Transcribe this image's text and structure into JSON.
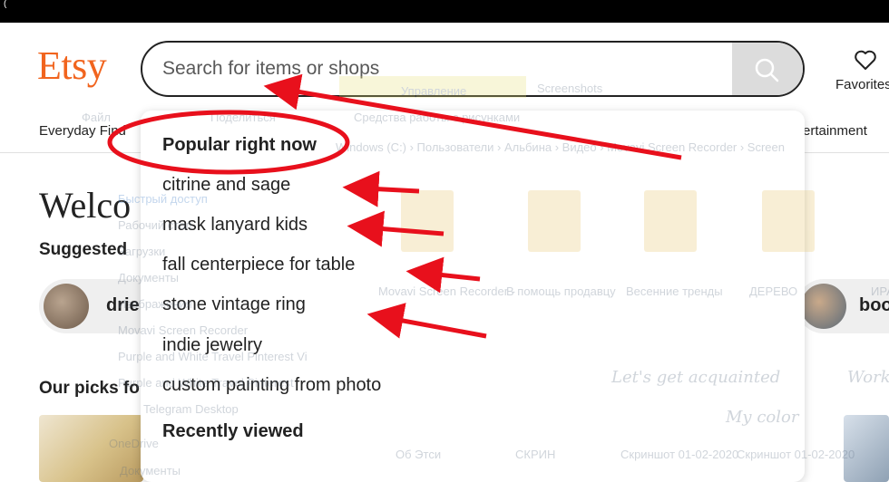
{
  "site": {
    "logo": "Etsy"
  },
  "search": {
    "placeholder": "Search for items or shops"
  },
  "header": {
    "favorites_label": "Favorites",
    "nav_left": "Everyday Find",
    "nav_right": "ertainment"
  },
  "main": {
    "welcome": "Welco",
    "suggested_heading": "Suggested",
    "suggested_left": "drie",
    "suggested_right": "boo",
    "picks_heading": "Our picks fo"
  },
  "dropdown": {
    "popular_heading": "Popular right now",
    "items": [
      "citrine and sage",
      "mask lanyard kids",
      "fall centerpiece for table",
      "stone vintage ring",
      "indie jewelry",
      "custom painting from photo"
    ],
    "recent_heading": "Recently viewed"
  },
  "ghost_window": {
    "ribbon_manage": "Управление",
    "ribbon_screenshots": "Screenshots",
    "file_tab": "Файл",
    "share_tab": "Поделиться",
    "tools_tab": "Средства работы с рисунками",
    "path": "Windows (C:) › Пользователи › Альбина › Видео › Movavi Screen Recorder › Screen",
    "quick_access": "Быстрый доступ",
    "desktop": "Рабочий стол",
    "downloads": "Загрузки",
    "documents": "Документы",
    "images": "Изображения",
    "movavi": "Movavi Screen Recorder",
    "purple1": "Purple and White Travel Pinterest Vi",
    "purple2": "Purple and White Travel Pinterest",
    "telegram": "Telegram Desktop",
    "onedrive": "OneDrive",
    "docs2": "Документы",
    "files": [
      "Movavi Screen Recorder -",
      "В помощь продавцу",
      "Весенние тренды",
      "ДЕРЕВО",
      "ИРА",
      "Об Этси",
      "СКРИН",
      "Скриншот 01-02-2020",
      "Скриншот 01-02-2020"
    ],
    "lets_get": "Let's get acquainted",
    "my_color": "My color",
    "work": "Work and p"
  },
  "colors": {
    "brand": "#F1641E",
    "annotation": "#E8101C"
  }
}
